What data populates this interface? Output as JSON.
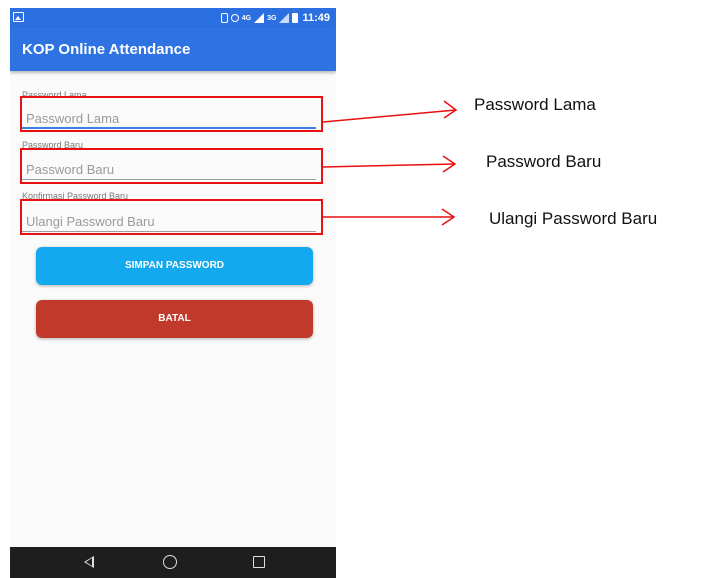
{
  "status_bar": {
    "time": "11:49",
    "data_badge": "4G",
    "signal_badge": "3G"
  },
  "app_bar": {
    "title": "KOP Online Attendance"
  },
  "form": {
    "fields": [
      {
        "label": "Password Lama",
        "placeholder": "Password Lama"
      },
      {
        "label": "Password Baru",
        "placeholder": "Password Baru"
      },
      {
        "label": "Konfirmasi Password Baru",
        "placeholder": "Ulangi Password Baru"
      }
    ],
    "save_button": "SIMPAN PASSWORD",
    "cancel_button": "BATAL"
  },
  "annotations": {
    "labels": [
      "Password Lama",
      "Password Baru",
      "Ulangi Password Baru"
    ],
    "highlight_color": "#e81010"
  },
  "colors": {
    "app_bar": "#2f73e2",
    "save_button": "#12a9ef",
    "cancel_button": "#c0392b",
    "nav_bar": "#1e1e1e"
  },
  "icons": {
    "status_left": "image-icon",
    "nav": [
      "back-icon",
      "home-icon",
      "recent-apps-icon"
    ]
  }
}
